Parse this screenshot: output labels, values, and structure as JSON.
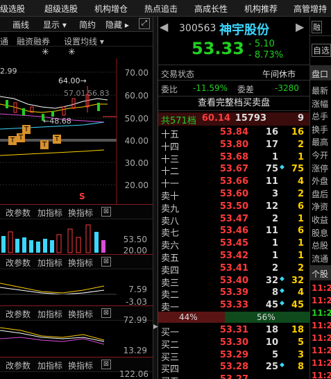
{
  "top_tabs": [
    "级选股",
    "超级选股",
    "机构增仓",
    "热点追击",
    "高成长性",
    "机构推荐",
    "高管增持"
  ],
  "toolbar": {
    "items": [
      "画线",
      "显示 ▾",
      "简约",
      "隐藏 ▸"
    ],
    "expand_icon": "expand-icon"
  },
  "chart_header": {
    "items": [
      "通",
      "融资融券",
      "设置均线 ▾"
    ],
    "star1": "✳",
    "star2": "✳"
  },
  "kline": {
    "price_left": "2.99",
    "high_label": "64.00→",
    "mid_label": "57.01",
    "mid_label2": "56.83",
    "low_label": "←48.68",
    "axis": [
      "70.00",
      "60.00",
      "50.00",
      "40.00",
      "30.00",
      "20.00"
    ],
    "t_marker": "T",
    "s_marker": "S"
  },
  "indicator_panes": [
    {
      "param": "改参数",
      "add": "加指标",
      "switch": "换指标",
      "close": "⊠",
      "axis_top": "53.50",
      "axis_bottom": "20.00"
    },
    {
      "param": "改参数",
      "add": "加指标",
      "switch": "换指标",
      "close": "⊠",
      "axis_top": "7.59",
      "axis_bottom": "-3.03"
    },
    {
      "param": "改参数",
      "add": "加指标",
      "switch": "换指标",
      "close": "⊠",
      "axis_top": "72.99",
      "axis_bottom": "13.29"
    },
    {
      "param": "改参数",
      "add": "加指标",
      "switch": "换指标",
      "close": "⊠",
      "axis_top": "122.06",
      "axis_bottom": ""
    }
  ],
  "stock": {
    "code": "300563",
    "name": "神宇股份",
    "price": "53.33",
    "change": "5.10",
    "change_pct": "8.73%",
    "margin_tag": "融",
    "self_select": "自选"
  },
  "status": {
    "label": "交易状态",
    "value": "午间休市",
    "weibi_label": "委比",
    "weibi_value": "-11.59%",
    "weicha_label": "委差",
    "weicha_value": "-3280",
    "full_book": "查看完整档买卖盘"
  },
  "sell_summary": {
    "label": "共571档",
    "price": "60.14",
    "vol": "15793",
    "ch": "9"
  },
  "asks": [
    {
      "label": "十五",
      "price": "53.84",
      "vol": "16",
      "ch": "16",
      "diamond": false
    },
    {
      "label": "十四",
      "price": "53.80",
      "vol": "17",
      "ch": "2",
      "diamond": false
    },
    {
      "label": "十三",
      "price": "53.68",
      "vol": "1",
      "ch": "1",
      "diamond": false
    },
    {
      "label": "十二",
      "price": "53.67",
      "vol": "75",
      "ch": "75",
      "diamond": true
    },
    {
      "label": "十一",
      "price": "53.66",
      "vol": "11",
      "ch": "4",
      "diamond": false
    },
    {
      "label": "卖十",
      "price": "53.60",
      "vol": "3",
      "ch": "2",
      "diamond": false
    },
    {
      "label": "卖九",
      "price": "53.50",
      "vol": "12",
      "ch": "6",
      "diamond": false
    },
    {
      "label": "卖八",
      "price": "53.47",
      "vol": "2",
      "ch": "1",
      "diamond": false
    },
    {
      "label": "卖七",
      "price": "53.46",
      "vol": "11",
      "ch": "6",
      "diamond": false
    },
    {
      "label": "卖六",
      "price": "53.45",
      "vol": "1",
      "ch": "1",
      "diamond": false
    },
    {
      "label": "卖五",
      "price": "53.42",
      "vol": "1",
      "ch": "1",
      "diamond": false
    },
    {
      "label": "卖四",
      "price": "53.41",
      "vol": "2",
      "ch": "2",
      "diamond": false
    },
    {
      "label": "卖三",
      "price": "53.40",
      "vol": "32",
      "ch": "32",
      "diamond": true
    },
    {
      "label": "卖二",
      "price": "53.39",
      "vol": "8",
      "ch": "4",
      "diamond": true
    },
    {
      "label": "卖一",
      "price": "53.33",
      "vol": "45",
      "ch": "45",
      "diamond": true
    }
  ],
  "ratio": {
    "left": "44%",
    "right": "56%",
    "left_fraction": 0.44
  },
  "bids": [
    {
      "label": "买一",
      "price": "53.31",
      "vol": "18",
      "ch": "18",
      "diamond": false
    },
    {
      "label": "买二",
      "price": "53.30",
      "vol": "10",
      "ch": "5",
      "diamond": false
    },
    {
      "label": "买三",
      "price": "53.29",
      "vol": "5",
      "ch": "3",
      "diamond": false
    },
    {
      "label": "买四",
      "price": "53.28",
      "vol": "25",
      "ch": "8",
      "diamond": true
    },
    {
      "label": "买五",
      "price": "53.27",
      "vol": "",
      "ch": "",
      "diamond": false
    }
  ],
  "side_panel": {
    "tab": "盘口",
    "items": [
      "最新",
      "涨幅",
      "总手",
      "换手",
      "最高",
      "今开",
      "涨停",
      "外盘",
      "盘后",
      "净资",
      "收益",
      "股息",
      "总股",
      "流通"
    ],
    "tab2": "个股",
    "times": [
      "11:2",
      "11:2",
      "11:2",
      "11:2",
      "11:2",
      "11:2",
      "11:2",
      "11:2",
      "11:2"
    ]
  }
}
